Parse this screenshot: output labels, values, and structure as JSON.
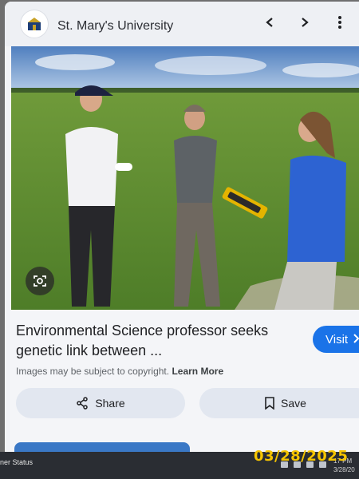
{
  "header": {
    "site_name": "St. Mary's University",
    "icons": [
      "back-arrow-icon",
      "forward-arrow-icon",
      "more-vert-icon"
    ]
  },
  "image": {
    "description_icon": "lens-search-icon"
  },
  "result": {
    "title_line1": "Environmental Science professor seeks",
    "title_line2": "genetic link between ...",
    "visit_label": "Visit",
    "copyright_text": "Images may be subject to copyright.",
    "learn_more": "Learn More",
    "share_label": "Share",
    "save_label": "Save"
  },
  "taskbar": {
    "status_text": "ner Status",
    "time": "17 PM",
    "date": "3/28/20"
  },
  "overlay": {
    "date_stamp": "03/28/2025"
  },
  "colors": {
    "visit_button": "#1a73e8",
    "date_stamp": "#f5c400"
  }
}
